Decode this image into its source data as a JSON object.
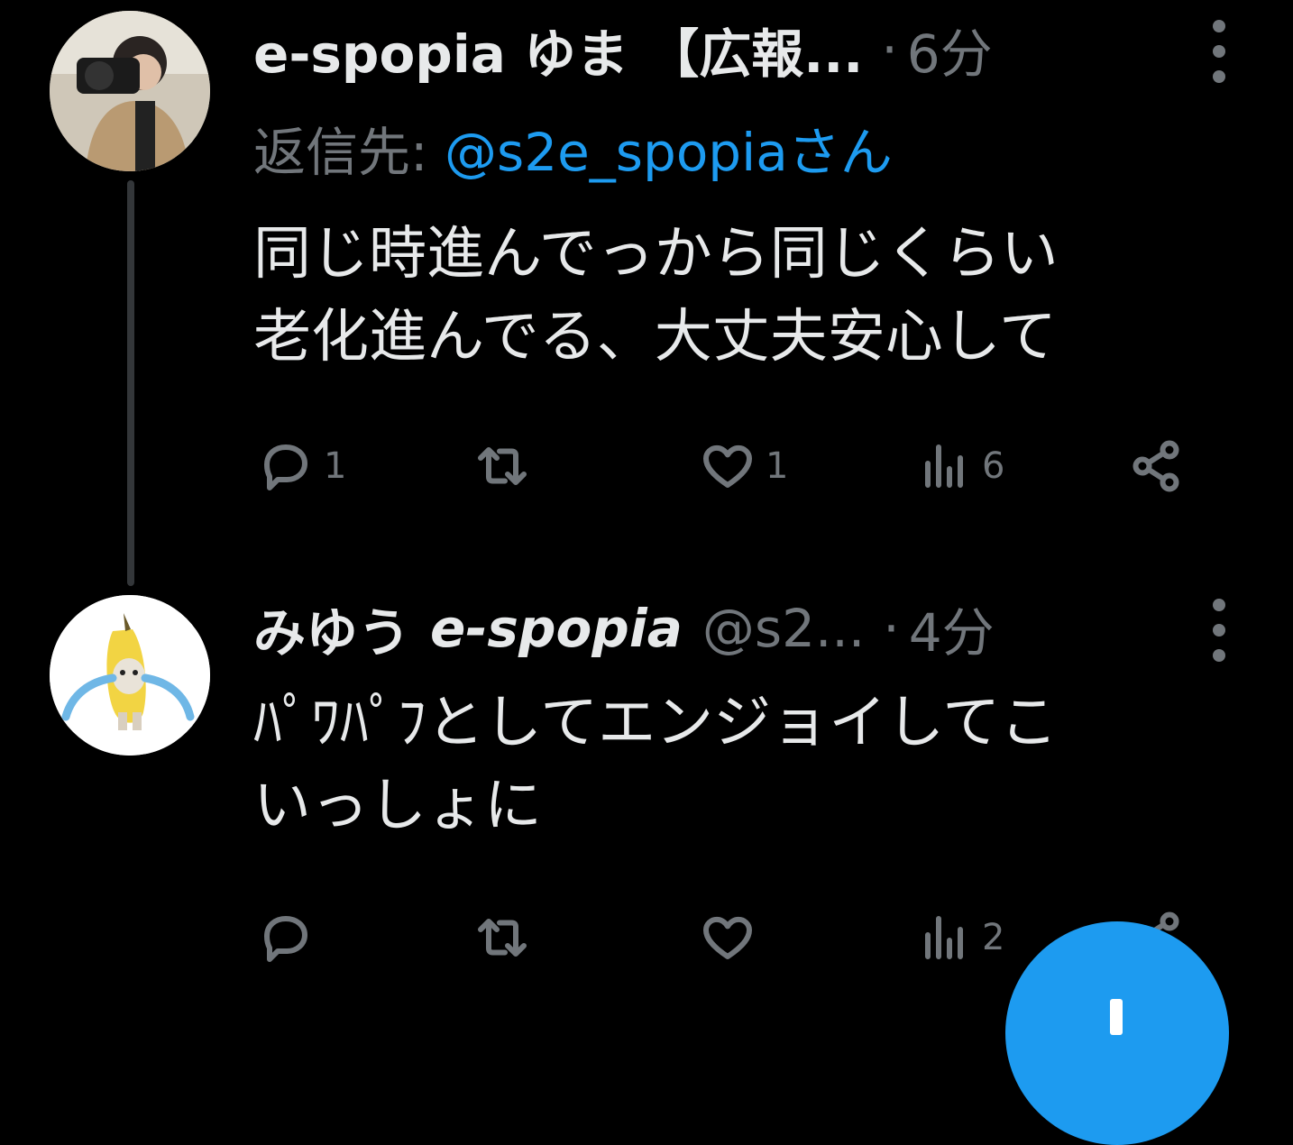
{
  "tweets": [
    {
      "author_name": "e-spopia ゆま 【広報...",
      "separator": "·",
      "time": "6分",
      "reply_label": "返信先:",
      "reply_mention": "@s2e_spopiaさん",
      "text_line1": "同じ時進んでっから同じくらい",
      "text_line2": "老化進んでる、大丈夫安心して",
      "reply_count": "1",
      "retweet_count": "",
      "like_count": "1",
      "view_count": "6"
    },
    {
      "author_name_jp": "みゆう",
      "author_name_en": "e-spopia",
      "handle": "@s2...",
      "separator": "·",
      "time": "4分",
      "text_line1": "ﾊﾟﾜﾊﾟﾌとしてエンジョイしてこ",
      "text_line2": "いっしょに",
      "reply_count": "",
      "retweet_count": "",
      "like_count": "",
      "view_count": "2"
    }
  ],
  "colors": {
    "background": "#000000",
    "text": "#e7e9ea",
    "muted": "#71767b",
    "accent": "#1d9bf0",
    "thread_line": "#333639"
  },
  "icons": [
    "reply-icon",
    "retweet-icon",
    "like-icon",
    "views-icon",
    "share-icon",
    "more-icon",
    "compose-icon"
  ]
}
